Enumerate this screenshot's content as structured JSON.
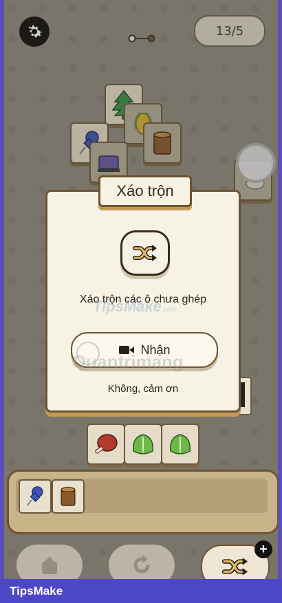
{
  "header": {
    "level_counter": "13/5",
    "settings_icon": "gear-icon",
    "progress_icon": "two-dot-progress-icon"
  },
  "board": {
    "tiles": [
      {
        "icon": "pine-tree-icon"
      },
      {
        "icon": "corn-icon"
      },
      {
        "icon": "push-pin-icon"
      },
      {
        "icon": "tree-stump-icon"
      },
      {
        "icon": "sewing-machine-icon"
      },
      {
        "icon": "cloud-sun-icon"
      }
    ]
  },
  "dialog": {
    "title": "Xáo trộn",
    "icon": "shuffle-icon",
    "description": "Xáo trộn các ô chưa ghép",
    "accept_label": "Nhận",
    "accept_icon": "video-camera-icon",
    "decline_label": "Không, cảm ơn",
    "watermark_text": "TipsMake",
    "watermark_sub": ".com",
    "watermark_text_2": "Quantrimang"
  },
  "matched_tiles": [
    {
      "icon": "meat-icon"
    },
    {
      "icon": "lettuce-icon"
    },
    {
      "icon": "lettuce-icon"
    }
  ],
  "tray": {
    "tiles": [
      {
        "icon": "push-pin-icon"
      },
      {
        "icon": "tree-stump-icon"
      }
    ]
  },
  "bottom_actions": [
    {
      "icon": "undo-tile-icon"
    },
    {
      "icon": "rotate-icon"
    },
    {
      "icon": "shuffle-icon"
    }
  ],
  "footer": {
    "brand": "TipsMake"
  },
  "colors": {
    "frame": "#5a50b8",
    "dialog_bg": "#f6f2e4",
    "dialog_border": "#6d5431",
    "footer_bg": "#4c46c8"
  }
}
